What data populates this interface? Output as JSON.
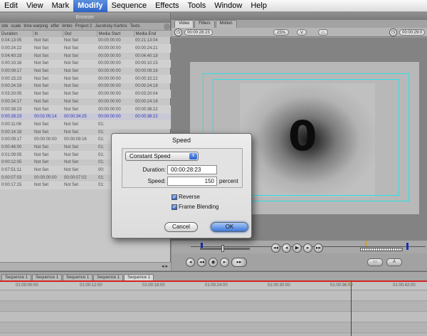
{
  "menubar": {
    "items": [
      {
        "label": "Edit",
        "active": false
      },
      {
        "label": "View",
        "active": false
      },
      {
        "label": "Mark",
        "active": false
      },
      {
        "label": "Modify",
        "active": true
      },
      {
        "label": "Sequence",
        "active": false
      },
      {
        "label": "Effects",
        "active": false
      },
      {
        "label": "Tools",
        "active": false
      },
      {
        "label": "Window",
        "active": false
      },
      {
        "label": "Help",
        "active": false
      }
    ]
  },
  "browser": {
    "title": "Browser",
    "tabs": [
      "site",
      "scale",
      "time warping",
      "effer",
      "limbo",
      "Project 2",
      "Jacobsky Kartins",
      "Texts"
    ],
    "columns": [
      "Duration",
      "In",
      "Out",
      "Media Start",
      "Media End"
    ],
    "rows": [
      [
        "0:04:13:05",
        "Not Set",
        "Not Set",
        "00:00:00:00",
        "00:21:13:04"
      ],
      [
        "0:00:24:22",
        "Not Set",
        "Not Set",
        "00:00:00:00",
        "00:00:24:21"
      ],
      [
        "0:04:40:19",
        "Not Set",
        "Not Set",
        "00:00:00:00",
        "00:04:40:18"
      ],
      [
        "0:00:10:16",
        "Not Set",
        "Not Set",
        "00:00:00:00",
        "00:00:10:15"
      ],
      [
        "0:00:09:17",
        "Not Set",
        "Not Set",
        "00:00:00:00",
        "00:00:09:16"
      ],
      [
        "0:00:15:23",
        "Not Set",
        "Not Set",
        "00:00:00:00",
        "00:00:15:22"
      ],
      [
        "0:00:24:19",
        "Not Set",
        "Not Set",
        "00:00:00:00",
        "00:00:24:18"
      ],
      [
        "0:03:20:05",
        "Not Set",
        "Not Set",
        "00:00:00:00",
        "00:03:20:04"
      ],
      [
        "0:00:24:17",
        "Not Set",
        "Not Set",
        "00:00:00:00",
        "00:00:24:16"
      ],
      [
        "0:00:38:23",
        "Not Set",
        "Not Set",
        "00:00:00:00",
        "00:00:38:22"
      ],
      [
        "0:00:28:23",
        "00:02:05:14",
        "00:00:34:25",
        "00:00:00:00",
        "00:00:38:22"
      ],
      [
        "0:00:11:06",
        "Not Set",
        "Not Set",
        "01:",
        ""
      ],
      [
        "0:00:14:18",
        "Not Set",
        "Not Set",
        "01:",
        ""
      ],
      [
        "0:00:09:17",
        "00:00:00:00",
        "00:00:09:16",
        "01:",
        ""
      ],
      [
        "0:00:46:00",
        "Not Set",
        "Not Set",
        "01:",
        ""
      ],
      [
        "0:01:09:05",
        "Not Set",
        "Not Set",
        "01:",
        ""
      ],
      [
        "0:00:12:05",
        "Not Set",
        "Not Set",
        "01:",
        ""
      ],
      [
        "0:07:51:11",
        "Not Set",
        "Not Set",
        "00:",
        ""
      ],
      [
        "0:00:07:03",
        "00:00:00:00",
        "00:00:07:02",
        "01:",
        ""
      ],
      [
        "0:00:17:15",
        "Not Set",
        "Not Set",
        "01:",
        ""
      ]
    ],
    "selected_row": 10,
    "scroll_arrows": "◂ ▸"
  },
  "viewer": {
    "tabs": [
      {
        "label": "Video",
        "active": true
      },
      {
        "label": "Filters",
        "active": false
      },
      {
        "label": "Motion",
        "active": false
      }
    ],
    "duration_timecode": "00:00:28:23",
    "zoom_label": "25%",
    "view_label": "V",
    "overlay_label": "□",
    "current_timecode": "00:00:29:0",
    "frame_text": "0",
    "transport_left": [
      "◂",
      "◂◂",
      "◉",
      "▸",
      "▸▸"
    ],
    "transport_right": [
      "◂◂",
      "◂",
      "▶",
      "▸",
      "▸▸"
    ]
  },
  "speed_dialog": {
    "title": "Speed",
    "mode_option": "Constant Speed",
    "duration_label": "Duration:",
    "duration_value": "00:00:28:23",
    "speed_label": "Speed:",
    "speed_value": "150",
    "speed_unit": "percent",
    "reverse_label": "Reverse",
    "reverse_checked": true,
    "frame_blending_label": "Frame Blending",
    "frame_blending_checked": true,
    "cancel_label": "Cancel",
    "ok_label": "OK"
  },
  "timeline": {
    "tabs": [
      {
        "label": "Sequence 1",
        "active": false
      },
      {
        "label": "Sequence 1",
        "active": false
      },
      {
        "label": "Sequence 1",
        "active": false
      },
      {
        "label": "Sequence 1",
        "active": false
      },
      {
        "label": "Sequence 1",
        "active": true
      }
    ],
    "ruler": [
      "01:00:00:00",
      "01:00:12:00",
      "01:00:18:00",
      "01:00:24:00",
      "01:00:30:00",
      "01:00:36:00",
      "01:00:42:00"
    ]
  }
}
